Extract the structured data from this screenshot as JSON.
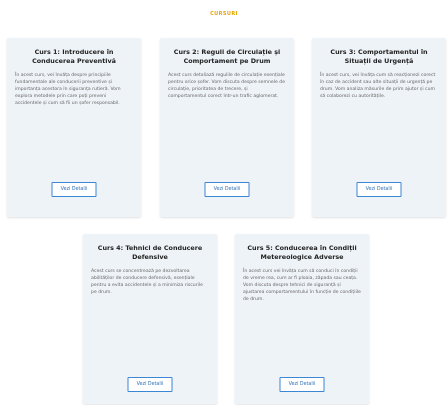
{
  "section": {
    "title": "CURSURI"
  },
  "courses": [
    {
      "title": "Curs 1: Introducere în Conducerea Preventivă",
      "description": "În acest curs, vei învăța despre principiile fundamentale ale conducerii preventive și importanța acestora în siguranța rutieră. Vom explora metodele prin care poți preveni accidentele și cum să fii un șofer responsabil.",
      "button_label": "Vezi Detalii"
    },
    {
      "title": "Curs 2: Reguli de Circulație și Comportament pe Drum",
      "description": "Acest curs detaliază regulile de circulație esențiale pentru orice șofer. Vom discuta despre semnele de circulație, prioritatea de trecere, și comportamentul corect într-un trafic aglomerat.",
      "button_label": "Vezi Detalii"
    },
    {
      "title": "Curs 3: Comportamentul în Situații de Urgență",
      "description": "În acest curs, vei învăța cum să reacționezi corect în caz de accident sau alte situații de urgență pe drum. Vom analiza măsurile de prim ajutor și cum să colaborezi cu autoritățile.",
      "button_label": "Vezi Detalii"
    },
    {
      "title": "Curs 4: Tehnici de Conducere Defensive",
      "description": "Acest curs se concentrează pe dezvoltarea abilităților de conducere defensivă, esențiale pentru a evita accidentele și a minimiza riscurile pe drum.",
      "button_label": "Vezi Detalii"
    },
    {
      "title": "Curs 5: Conducerea în Condiții Metereologice Adverse",
      "description": "În acest curs vei învăța cum să conduci în condiții de vreme rea, cum ar fi ploaia, zăpada sau ceața. Vom discuta despre tehnici de siguranță și ajustarea comportamentului în funcție de condițiile de drum.",
      "button_label": "Vezi Detalii"
    }
  ]
}
